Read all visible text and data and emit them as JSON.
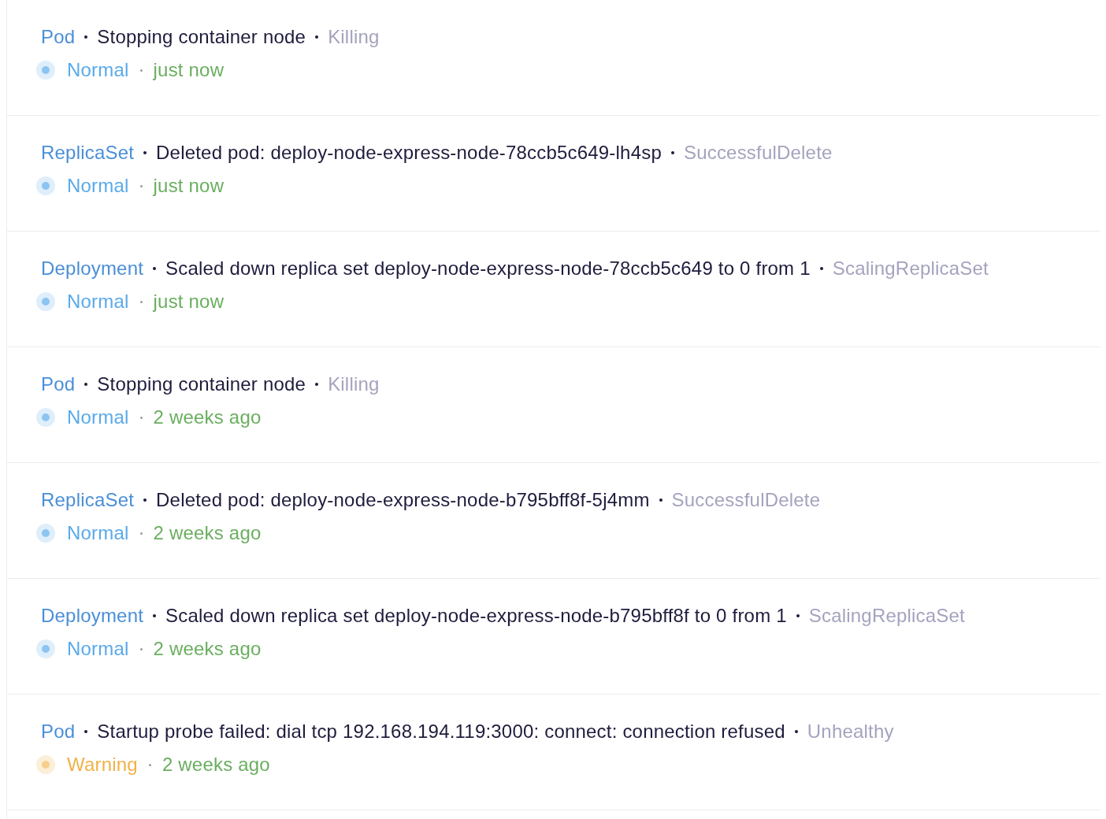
{
  "events": [
    {
      "source": "Pod",
      "message": "Stopping container node",
      "reason": "Killing",
      "kind": "normal",
      "type": "Normal",
      "time": "just now"
    },
    {
      "source": "ReplicaSet",
      "message": "Deleted pod: deploy-node-express-node-78ccb5c649-lh4sp",
      "reason": "SuccessfulDelete",
      "kind": "normal",
      "type": "Normal",
      "time": "just now"
    },
    {
      "source": "Deployment",
      "message": "Scaled down replica set deploy-node-express-node-78ccb5c649 to 0 from 1",
      "reason": "ScalingReplicaSet",
      "kind": "normal",
      "type": "Normal",
      "time": "just now"
    },
    {
      "source": "Pod",
      "message": "Stopping container node",
      "reason": "Killing",
      "kind": "normal",
      "type": "Normal",
      "time": "2 weeks ago"
    },
    {
      "source": "ReplicaSet",
      "message": "Deleted pod: deploy-node-express-node-b795bff8f-5j4mm",
      "reason": "SuccessfulDelete",
      "kind": "normal",
      "type": "Normal",
      "time": "2 weeks ago"
    },
    {
      "source": "Deployment",
      "message": "Scaled down replica set deploy-node-express-node-b795bff8f to 0 from 1",
      "reason": "ScalingReplicaSet",
      "kind": "normal",
      "type": "Normal",
      "time": "2 weeks ago"
    },
    {
      "source": "Pod",
      "message": "Startup probe failed: dial tcp 192.168.194.119:3000: connect: connection refused",
      "reason": "Unhealthy",
      "kind": "warning",
      "type": "Warning",
      "time": "2 weeks ago"
    }
  ]
}
